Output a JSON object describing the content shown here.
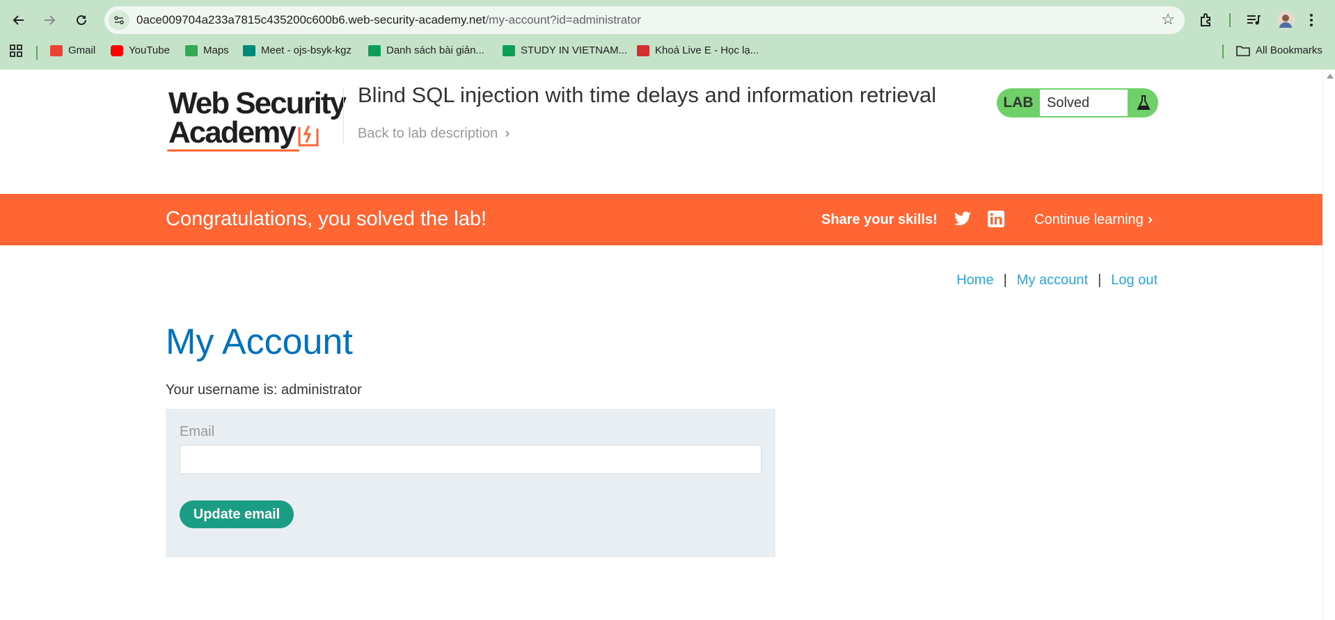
{
  "browser": {
    "url_host": "0ace009704a233a7815c435200c600b6.web-security-academy.net",
    "url_path": "/my-account?id=administrator",
    "bookmarks": [
      {
        "label": "Gmail",
        "icon": "gmail-icon",
        "color": "#ea4335"
      },
      {
        "label": "YouTube",
        "icon": "youtube-icon",
        "color": "#ff0000"
      },
      {
        "label": "Maps",
        "icon": "maps-icon",
        "color": "#34a853"
      },
      {
        "label": "Meet - ojs-bsyk-kgz",
        "icon": "meet-icon",
        "color": "#00897b"
      },
      {
        "label": "Danh sách bài giản...",
        "icon": "sheets-icon",
        "color": "#0f9d58"
      },
      {
        "label": "STUDY IN VIETNAM...",
        "icon": "sheets-icon",
        "color": "#0f9d58"
      },
      {
        "label": "Khoá Live E - Học lạ...",
        "icon": "live-icon",
        "color": "#d32f2f"
      }
    ],
    "all_bookmarks": "All Bookmarks"
  },
  "header": {
    "logo_line1": "Web Security",
    "logo_line2": "Academy",
    "lab_title": "Blind SQL injection with time delays and information retrieval",
    "back_link": "Back to lab description",
    "lab_badge": "LAB",
    "lab_status": "Solved"
  },
  "banner": {
    "message": "Congratulations, you solved the lab!",
    "share": "Share your skills!",
    "continue": "Continue learning"
  },
  "nav": {
    "home": "Home",
    "my_account": "My account",
    "log_out": "Log out",
    "separator": "|"
  },
  "main": {
    "title": "My Account",
    "username_text": "Your username is: administrator",
    "email_label": "Email",
    "email_value": "",
    "update_button": "Update email"
  },
  "colors": {
    "banner": "#ff6633",
    "heading": "#0071bc",
    "link": "#29a8e0",
    "button": "#1b9c85",
    "lab_green": "#70d16a"
  }
}
